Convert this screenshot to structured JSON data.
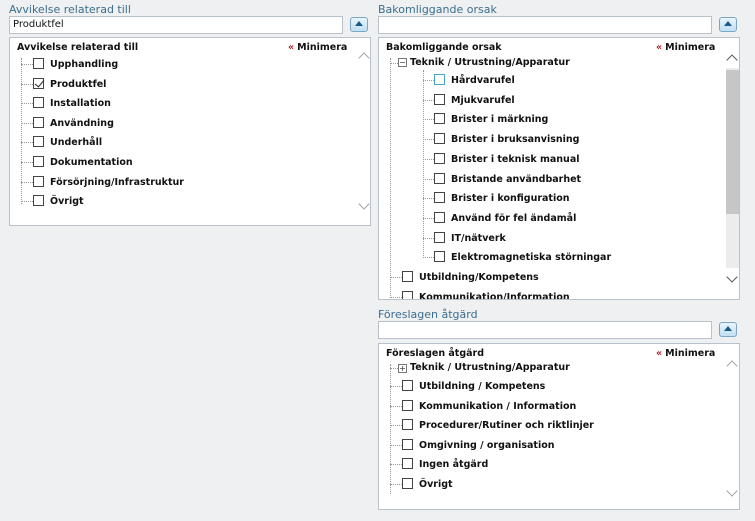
{
  "left": {
    "title": "Avvikelse relaterad till",
    "field_value": "Produktfel",
    "panel_title": "Avvikelse relaterad till",
    "minimize": "Minimera",
    "minimize_symbol": "«",
    "items": [
      {
        "label": "Upphandling",
        "checked": false
      },
      {
        "label": "Produktfel",
        "checked": true
      },
      {
        "label": "Installation",
        "checked": false
      },
      {
        "label": "Användning",
        "checked": false
      },
      {
        "label": "Underhåll",
        "checked": false
      },
      {
        "label": "Dokumentation",
        "checked": false
      },
      {
        "label": "Försörjning/Infrastruktur",
        "checked": false
      },
      {
        "label": "Övrigt",
        "checked": false
      }
    ]
  },
  "cause": {
    "title": "Bakomliggande orsak",
    "field_value": "",
    "panel_title": "Bakomliggande orsak",
    "minimize": "Minimera",
    "minimize_symbol": "«",
    "group_label": "Teknik / Utrustning/Apparatur",
    "group_expander": "−",
    "children": [
      "Hårdvarufel",
      "Mjukvarufel",
      "Brister i märkning",
      "Brister i bruksanvisning",
      "Brister i teknisk manual",
      "Bristande användbarhet",
      "Brister i konfiguration",
      "Använd för fel ändamål",
      "IT/nätverk",
      "Elektromagnetiska störningar"
    ],
    "siblings": [
      "Utbildning/Kompetens",
      "Kommunikation/Information"
    ]
  },
  "action": {
    "title": "Föreslagen åtgärd",
    "field_value": "",
    "panel_title": "Föreslagen åtgärd",
    "minimize": "Minimera",
    "minimize_symbol": "«",
    "group_label": "Teknik / Utrustning/Apparatur",
    "group_expander": "+",
    "items": [
      "Utbildning / Kompetens",
      "Kommunikation / Information",
      "Procedurer/Rutiner och riktlinjer",
      "Omgivning / organisation",
      "Ingen åtgärd",
      "Övrigt"
    ]
  }
}
